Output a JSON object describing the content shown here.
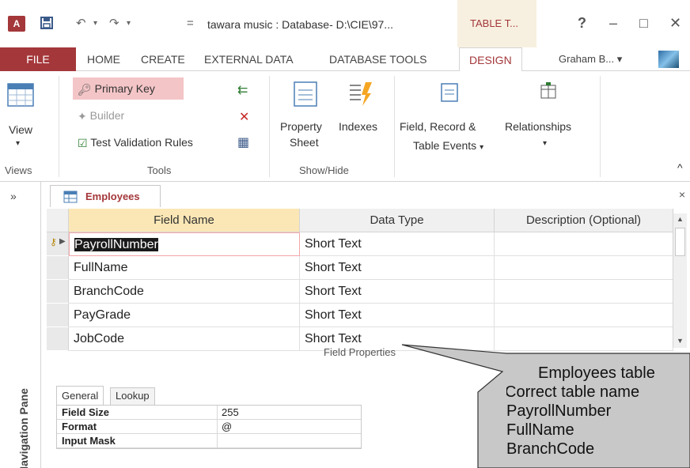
{
  "titlebar": {
    "logo": "A",
    "undo_symbol": "↶",
    "redo_symbol": "↷",
    "qat_more": "=",
    "title": "tawara music : Database- D:\\CIE\\97...",
    "context_tab": "TABLE T...",
    "help": "?",
    "minimize": "–",
    "maximize": "□",
    "close": "✕"
  },
  "tabs": {
    "file": "FILE",
    "home": "HOME",
    "create": "CREATE",
    "external": "EXTERNAL DATA",
    "dbtools": "DATABASE TOOLS",
    "design": "DESIGN",
    "user": "Graham B...",
    "user_caret": "▾"
  },
  "ribbon": {
    "view_label": "View",
    "view_caret": "▾",
    "views_group": "Views",
    "primary_key": "Primary Key",
    "builder": "Builder",
    "test_validation": "Test Validation Rules",
    "tools_group": "Tools",
    "property_sheet_1": "Property",
    "property_sheet_2": "Sheet",
    "indexes": "Indexes",
    "showhide_group": "Show/Hide",
    "events_1": "Field, Record &",
    "events_2": "Table Events",
    "events_caret": "▾",
    "relationships": "Relationships",
    "relationships_caret": "▾",
    "collapse": "^"
  },
  "nav": {
    "toggle": "»",
    "label": "Navigation Pane"
  },
  "document": {
    "tab_name": "Employees",
    "close": "×",
    "columns": [
      "Field Name",
      "Data Type",
      "Description (Optional)"
    ],
    "rows": [
      {
        "field": "PayrollNumber",
        "type": "Short Text",
        "desc": ""
      },
      {
        "field": "FullName",
        "type": "Short Text",
        "desc": ""
      },
      {
        "field": "BranchCode",
        "type": "Short Text",
        "desc": ""
      },
      {
        "field": "PayGrade",
        "type": "Short Text",
        "desc": ""
      },
      {
        "field": "JobCode",
        "type": "Short Text",
        "desc": ""
      }
    ],
    "field_properties": "Field Properties",
    "prop_tabs": [
      "General",
      "Lookup"
    ],
    "properties": [
      {
        "name": "Field Size",
        "value": "255"
      },
      {
        "name": "Format",
        "value": "@"
      },
      {
        "name": "Input Mask",
        "value": ""
      }
    ]
  },
  "callout": {
    "lines": [
      "Employees table",
      "Correct table name",
      "PayrollNumber",
      "FullName",
      "BranchCode"
    ]
  },
  "colors": {
    "access_red": "#a4373a",
    "header_active": "#fbe7b6",
    "callout_fill": "#c8c8c8"
  }
}
